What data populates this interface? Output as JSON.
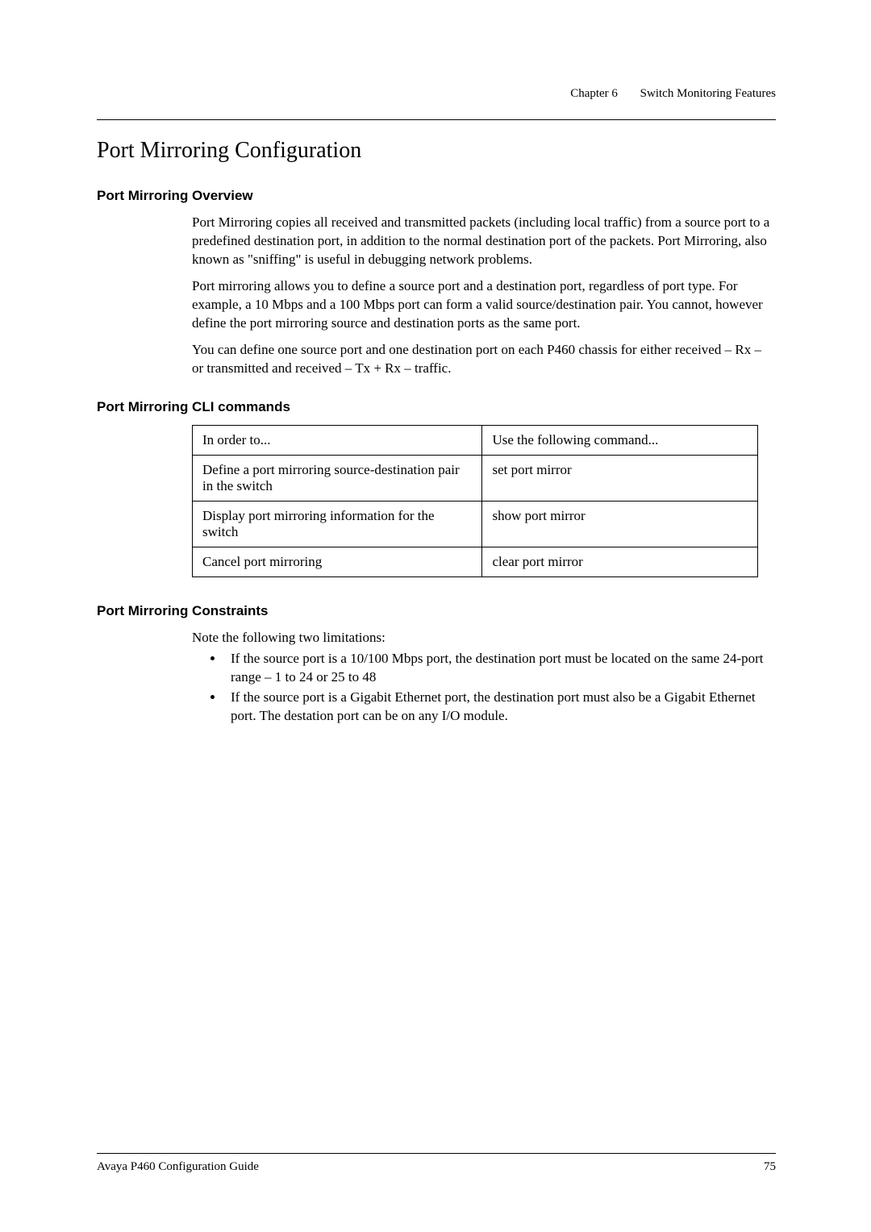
{
  "header": {
    "chapter": "Chapter 6",
    "title": "Switch Monitoring Features"
  },
  "main_heading": "Port Mirroring Configuration",
  "overview": {
    "heading": "Port Mirroring Overview",
    "p1": "Port Mirroring copies all received and transmitted packets (including local traffic) from a source port to a predefined destination port, in addition to the normal destination port of the packets. Port Mirroring, also known as \"sniffing\" is useful in debugging network problems.",
    "p2": "Port mirroring allows you to define a source port and a destination port, regardless of port type. For example, a 10 Mbps and a 100 Mbps port can form a valid source/destination pair. You cannot, however define the port mirroring source and destination ports as the same port.",
    "p3": "You can define one source port and one destination port on each P460 chassis for either received – Rx – or transmitted and received – Tx + Rx – traffic."
  },
  "cli": {
    "heading": "Port Mirroring CLI commands",
    "header_row": {
      "left": "In order to...",
      "right": "Use the following command..."
    },
    "rows": [
      {
        "left": "Define a port mirroring source-destination pair in the switch",
        "right": "set port mirror"
      },
      {
        "left": "Display port mirroring information for the switch",
        "right": "show port mirror"
      },
      {
        "left": "Cancel port mirroring",
        "right": "clear port mirror"
      }
    ]
  },
  "constraints": {
    "heading": "Port Mirroring Constraints",
    "intro": "Note the following two limitations:",
    "items": [
      "If the source port is a 10/100 Mbps port, the destination port must be located on the same 24-port range – 1 to 24 or 25 to 48",
      "If the source port is a Gigabit Ethernet port, the destination port must also be a Gigabit Ethernet port. The destation port can be on any I/O module."
    ]
  },
  "footer": {
    "guide": "Avaya P460 Configuration Guide",
    "page": "75"
  }
}
